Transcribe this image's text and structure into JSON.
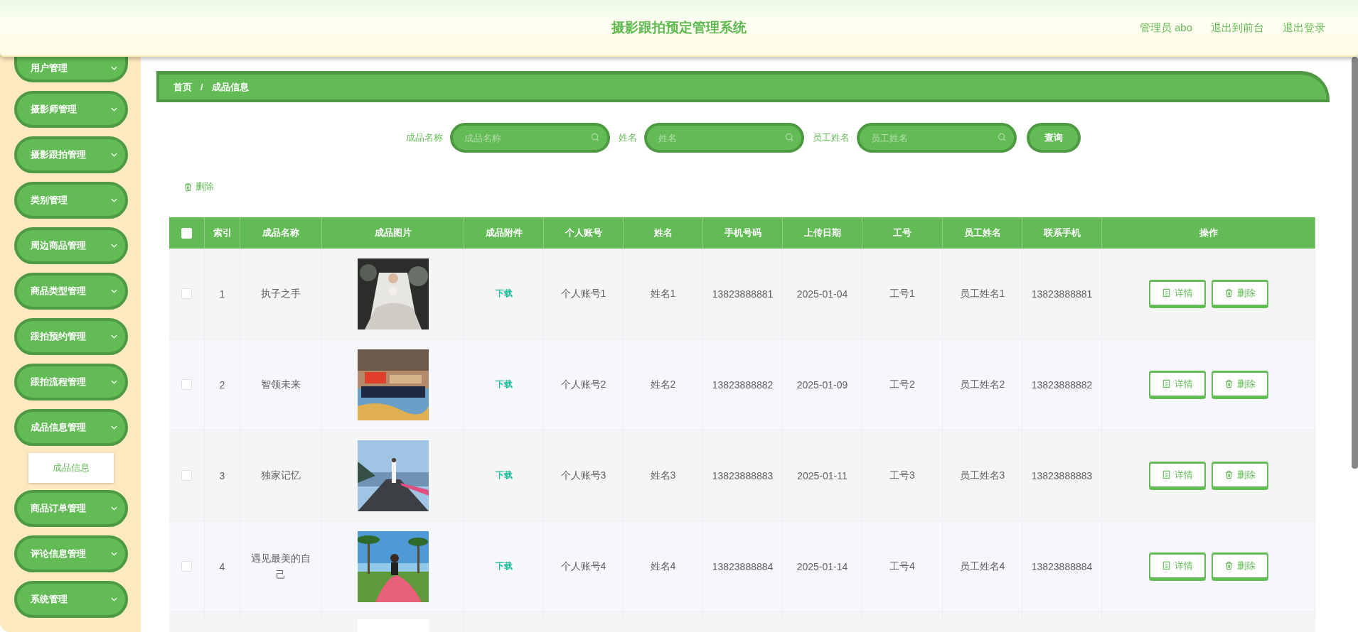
{
  "header": {
    "title": "摄影跟拍预定管理系统",
    "links": [
      "管理员 abo",
      "退出到前台",
      "退出登录"
    ]
  },
  "sidebar": {
    "items": [
      {
        "label": "用户管理"
      },
      {
        "label": "摄影师管理"
      },
      {
        "label": "摄影跟拍管理"
      },
      {
        "label": "类别管理"
      },
      {
        "label": "周边商品管理"
      },
      {
        "label": "商品类型管理"
      },
      {
        "label": "跟拍预约管理"
      },
      {
        "label": "跟拍流程管理"
      },
      {
        "label": "成品信息管理",
        "children": [
          {
            "label": "成品信息",
            "selected": true
          }
        ]
      },
      {
        "label": "商品订单管理"
      },
      {
        "label": "评论信息管理"
      },
      {
        "label": "系统管理"
      }
    ]
  },
  "breadcrumb": [
    "首页",
    "/",
    "成品信息"
  ],
  "search": {
    "fields": [
      {
        "label": "成品名称",
        "placeholder": "成品名称"
      },
      {
        "label": "姓名",
        "placeholder": "姓名"
      },
      {
        "label": "员工姓名",
        "placeholder": "员工姓名"
      }
    ],
    "button": "查询"
  },
  "toolbar": {
    "delete": "删除"
  },
  "table": {
    "select_all": {
      "checked": false
    },
    "columns": [
      "索引",
      "成品名称",
      "成品图片",
      "成品附件",
      "个人账号",
      "姓名",
      "手机号码",
      "上传日期",
      "工号",
      "员工姓名",
      "联系手机",
      "操作"
    ],
    "rows": [
      {
        "checked": false,
        "index": "1",
        "name": "执子之手",
        "image": {
          "kind": "picture"
        },
        "attachment": "下载",
        "account": "个人账号1",
        "person": "姓名1",
        "phone": "13823888881",
        "date": "2025-01-04",
        "staff_no": "工号1",
        "staff_name": "员工姓名1",
        "contact": "13823888881",
        "actions": [
          "详情",
          "删除"
        ]
      },
      {
        "checked": false,
        "index": "2",
        "name": "智领未来",
        "image": {
          "kind": "picture"
        },
        "attachment": "下载",
        "account": "个人账号2",
        "person": "姓名2",
        "phone": "13823888882",
        "date": "2025-01-09",
        "staff_no": "工号2",
        "staff_name": "员工姓名2",
        "contact": "13823888882",
        "actions": [
          "详情",
          "删除"
        ]
      },
      {
        "checked": false,
        "index": "3",
        "name": "独家记忆",
        "image": {
          "kind": "picture"
        },
        "attachment": "下载",
        "account": "个人账号3",
        "person": "姓名3",
        "phone": "13823888883",
        "date": "2025-01-11",
        "staff_no": "工号3",
        "staff_name": "员工姓名3",
        "contact": "13823888883",
        "actions": [
          "详情",
          "删除"
        ]
      },
      {
        "checked": false,
        "index": "4",
        "name": "遇见最美的自己",
        "image": {
          "kind": "picture"
        },
        "attachment": "下载",
        "account": "个人账号4",
        "person": "姓名4",
        "phone": "13823888884",
        "date": "2025-01-14",
        "staff_no": "工号4",
        "staff_name": "员工姓名4",
        "contact": "13823888884",
        "actions": [
          "详情",
          "删除"
        ]
      },
      {
        "image": {
          "kind": "picture"
        }
      }
    ]
  }
}
